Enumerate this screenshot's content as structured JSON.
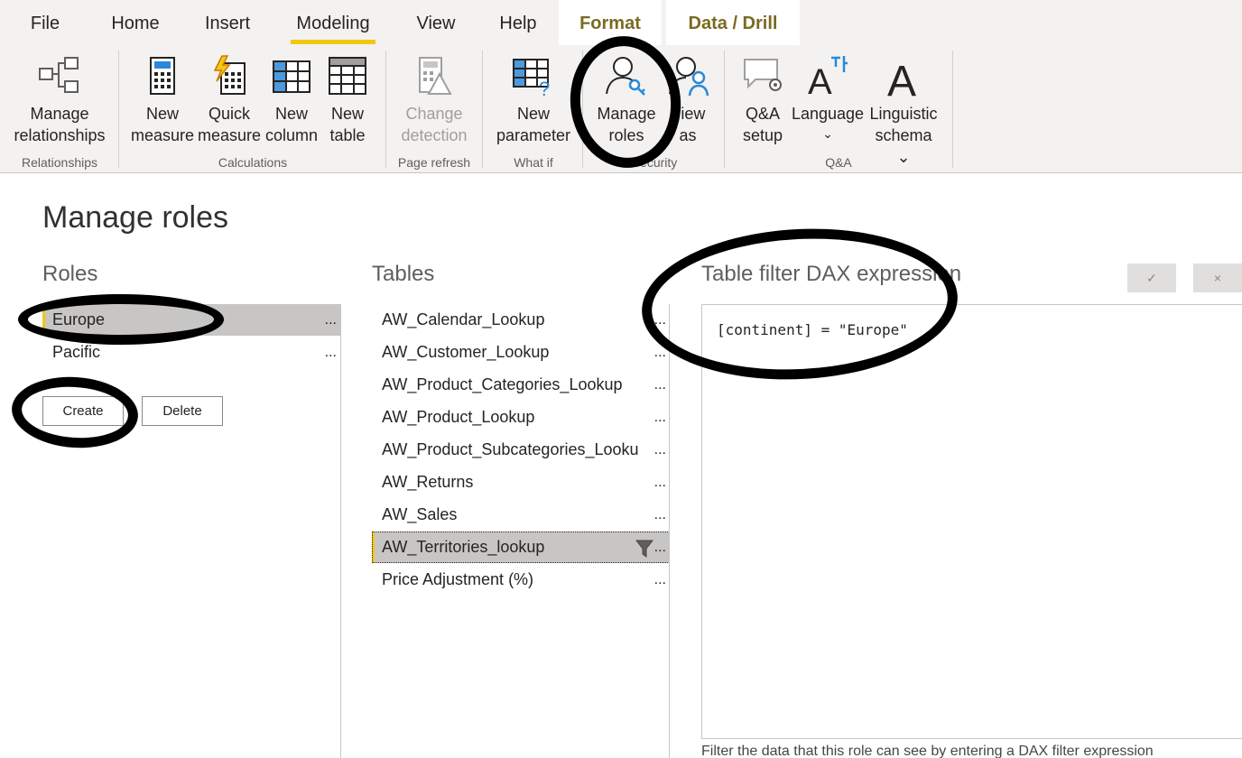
{
  "ribbon": {
    "tabs": [
      {
        "label": "File"
      },
      {
        "label": "Home"
      },
      {
        "label": "Insert"
      },
      {
        "label": "Modeling"
      },
      {
        "label": "View"
      },
      {
        "label": "Help"
      },
      {
        "label": "Format"
      },
      {
        "label": "Data / Drill"
      }
    ],
    "active_tab": "Modeling",
    "buttons": {
      "manage_relationships": [
        "Manage",
        "relationships"
      ],
      "new_measure": [
        "New",
        "measure"
      ],
      "quick_measure": [
        "Quick",
        "measure"
      ],
      "new_column": [
        "New",
        "column"
      ],
      "new_table": [
        "New",
        "table"
      ],
      "change_detection": [
        "Change",
        "detection"
      ],
      "new_parameter": [
        "New",
        "parameter"
      ],
      "manage_roles": [
        "Manage",
        "roles"
      ],
      "view_as": [
        "View",
        "as"
      ],
      "qa_setup": [
        "Q&A",
        "setup"
      ],
      "language": [
        "Language",
        "⌄"
      ],
      "linguistic_schema": [
        "Linguistic",
        "schema ⌄"
      ]
    },
    "groups": {
      "relationships": "Relationships",
      "calculations": "Calculations",
      "page_refresh": "Page refresh",
      "what_if": "What if",
      "security": "Security",
      "qa": "Q&A"
    }
  },
  "dialog": {
    "title": "Manage roles",
    "roles_heading": "Roles",
    "roles": [
      {
        "name": "Europe",
        "more": "..."
      },
      {
        "name": "Pacific",
        "more": "..."
      }
    ],
    "create_label": "Create",
    "delete_label": "Delete",
    "tables_heading": "Tables",
    "tables": [
      {
        "name": "AW_Calendar_Lookup",
        "more": "..."
      },
      {
        "name": "AW_Customer_Lookup",
        "more": "..."
      },
      {
        "name": "AW_Product_Categories_Lookup",
        "more": "..."
      },
      {
        "name": "AW_Product_Lookup",
        "more": "..."
      },
      {
        "name": "AW_Product_Subcategories_Looku",
        "more": "..."
      },
      {
        "name": "AW_Returns",
        "more": "..."
      },
      {
        "name": "AW_Sales",
        "more": "..."
      },
      {
        "name": "AW_Territories_lookup",
        "more": "..."
      },
      {
        "name": "Price Adjustment (%)",
        "more": "..."
      }
    ],
    "selected_role": "Europe",
    "selected_table": "AW_Territories_lookup",
    "dax_heading": "Table filter DAX expression",
    "dax_expression": "[continent] = \"Europe\"",
    "accept_icon": "✓",
    "cancel_icon": "×",
    "hint": "Filter the data that this role can see by entering a DAX filter expression"
  },
  "colors": {
    "accent": "#f2c811",
    "ribbon_bg": "#f3f2f1",
    "selection_bg": "#c8c6c4",
    "context_tab_text": "#7b6a21",
    "icon_blue": "#2b88d8"
  }
}
